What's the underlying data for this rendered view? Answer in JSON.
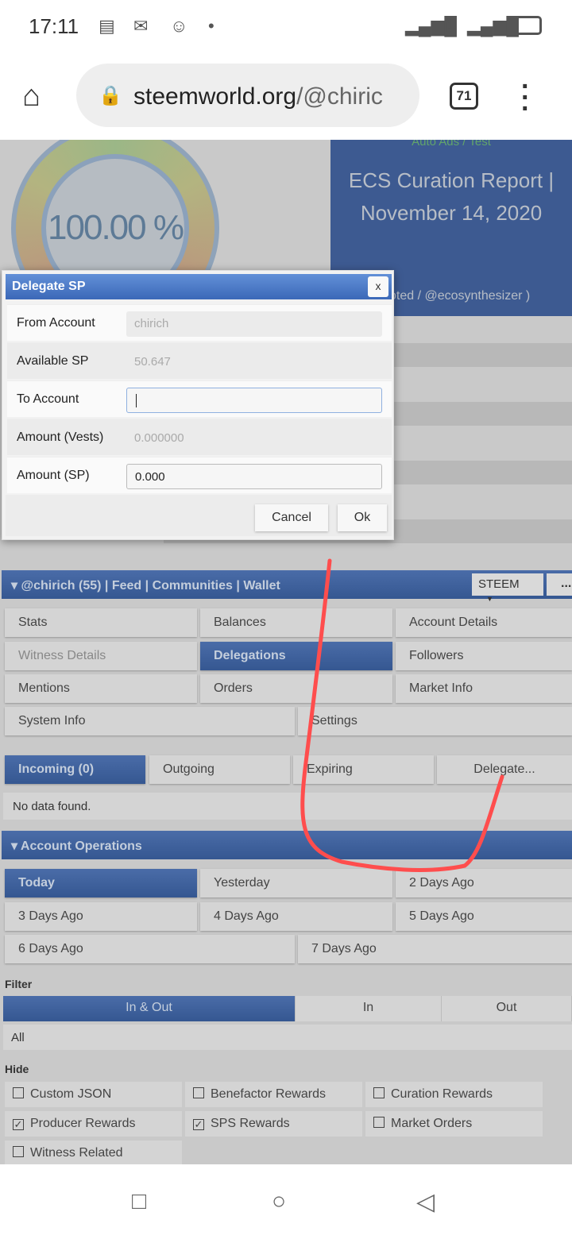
{
  "status": {
    "time": "17:11",
    "icons": [
      "message-icon",
      "gmail-icon",
      "chat-icon",
      "dot-icon"
    ],
    "right_icons": [
      "signal-icon",
      "data-arrows-icon",
      "hplus-signal-icon",
      "battery-icon"
    ]
  },
  "browser": {
    "url_host": "steemworld.org",
    "url_path": "/@chiric",
    "tab_count": "71"
  },
  "background": {
    "gauge_value": "100.00 %",
    "ad_tag": "Auto Ads / Test",
    "ad_title": "ECS Curation Report | November 14, 2020",
    "ad_by": "oted / @ecosynthesizer )"
  },
  "modal": {
    "title": "Delegate SP",
    "close": "x",
    "fields": [
      {
        "label": "From Account",
        "value": "chirich"
      },
      {
        "label": "Available SP",
        "value": "50.647"
      },
      {
        "label": "To Account",
        "value": ""
      },
      {
        "label": "Amount (Vests)",
        "value": "0.000000"
      },
      {
        "label": "Amount (SP)",
        "value": "0.000"
      }
    ],
    "cancel": "Cancel",
    "ok": "Ok"
  },
  "navbar": {
    "items": [
      "@chirich (55)",
      "|",
      "Feed",
      "|",
      "Communities",
      "|",
      "Wallet"
    ],
    "select": "STEEM",
    "more": "..."
  },
  "tabs": [
    "Stats",
    "Balances",
    "Account Details",
    "Witness Details",
    "Delegations",
    "Followers",
    "Mentions",
    "Orders",
    "Market Info",
    "System Info",
    "Settings"
  ],
  "delegations": {
    "tabs": [
      "Incoming (0)",
      "Outgoing",
      "Expiring",
      "Delegate..."
    ],
    "empty": "No data found."
  },
  "operations": {
    "title": "Account Operations",
    "days": [
      "Today",
      "Yesterday",
      "2 Days Ago",
      "3 Days Ago",
      "4 Days Ago",
      "5 Days Ago",
      "6 Days Ago",
      "7 Days Ago"
    ],
    "filter_label": "Filter",
    "filter": [
      "In & Out",
      "In",
      "Out"
    ],
    "filter_value": "All",
    "hide_label": "Hide",
    "hide": [
      {
        "label": "Custom JSON",
        "checked": false
      },
      {
        "label": "Benefactor Rewards",
        "checked": false
      },
      {
        "label": "Curation Rewards",
        "checked": false
      },
      {
        "label": "Producer Rewards",
        "checked": true
      },
      {
        "label": "SPS Rewards",
        "checked": true
      },
      {
        "label": "Market Orders",
        "checked": false
      },
      {
        "label": "Witness Related",
        "checked": false
      }
    ]
  },
  "annotation_color": "#ff4d4d"
}
